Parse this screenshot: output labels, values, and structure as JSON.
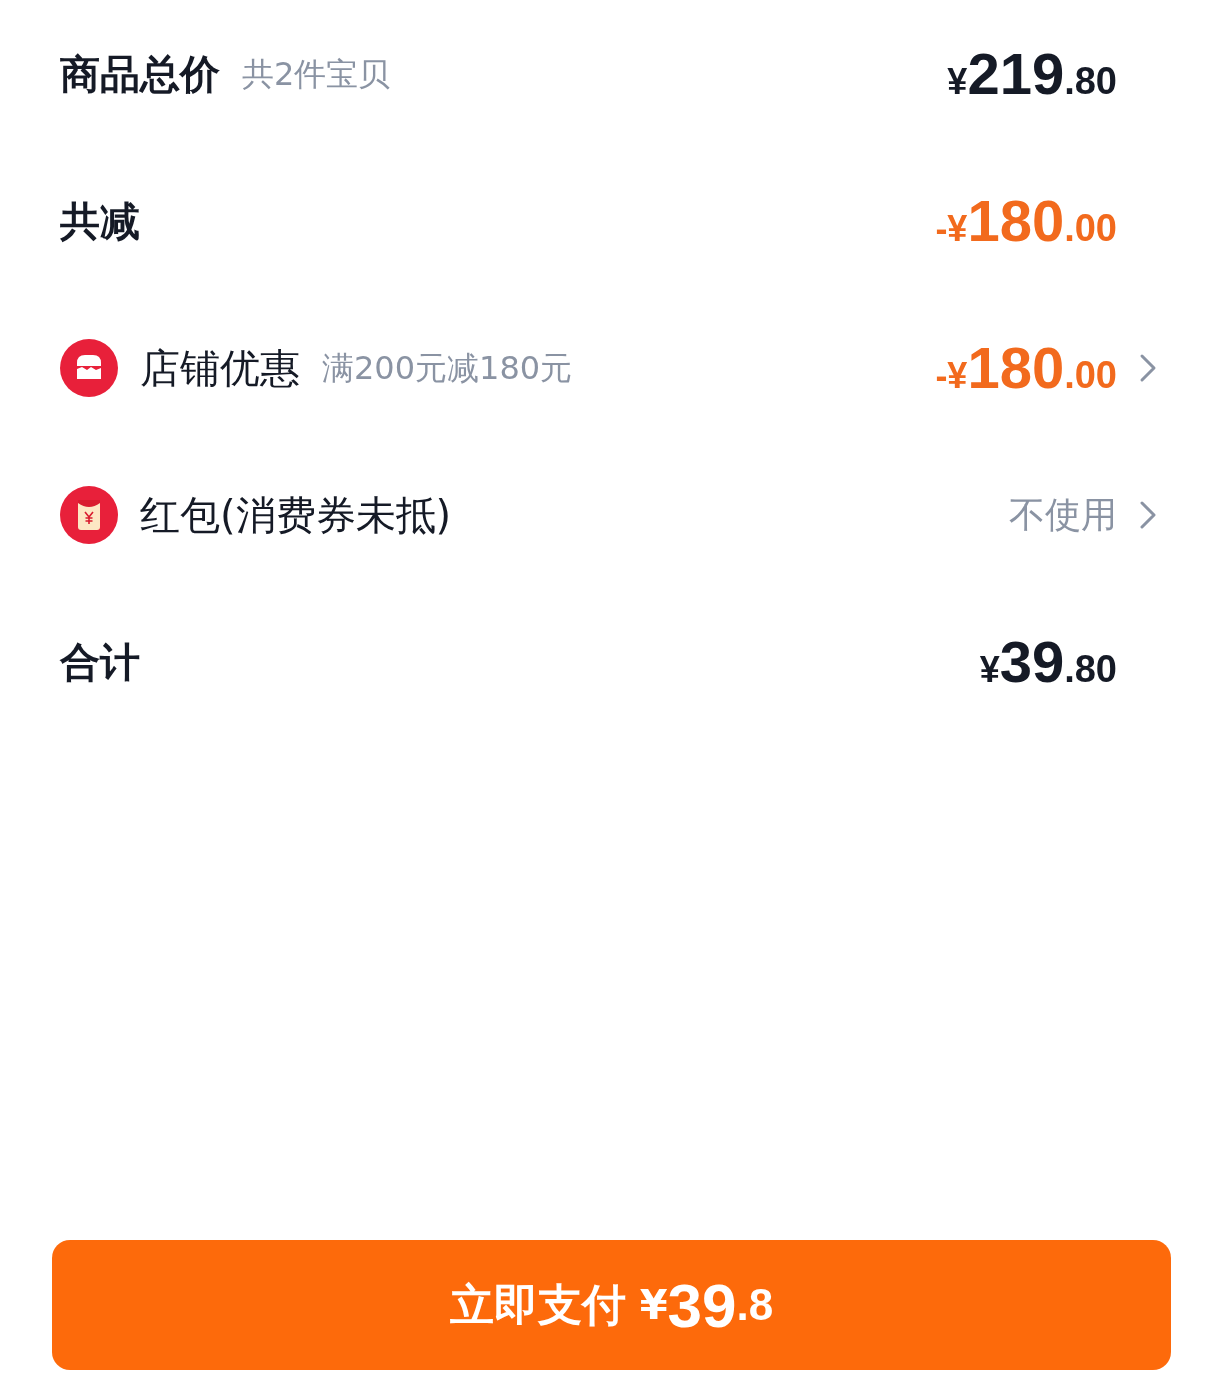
{
  "rows": [
    {
      "kind": "plain",
      "label": "商品总价",
      "note": "共2件宝贝",
      "price": {
        "currency": "¥",
        "integer": "219",
        "decimal": ".80"
      },
      "highlight": false
    },
    {
      "kind": "plain",
      "label": "共减",
      "price": {
        "sign": "-",
        "currency": "¥",
        "integer": "180",
        "decimal": ".00"
      },
      "highlight": true
    },
    {
      "kind": "shop",
      "label": "店铺优惠",
      "note": "满200元减180元",
      "price": {
        "sign": "-",
        "currency": "¥",
        "integer": "180",
        "decimal": ".00"
      },
      "highlight": true,
      "chevron": true
    },
    {
      "kind": "packet",
      "label": "红包(消费券未抵)",
      "value": "不使用",
      "chevron": true
    },
    {
      "kind": "plain",
      "label": "合计",
      "price": {
        "currency": "¥",
        "integer": "39",
        "decimal": ".80"
      },
      "highlight": false
    }
  ],
  "pay_button": {
    "label": "立即支付",
    "price": {
      "currency": "¥",
      "integer": "39",
      "decimal": ".8"
    }
  }
}
